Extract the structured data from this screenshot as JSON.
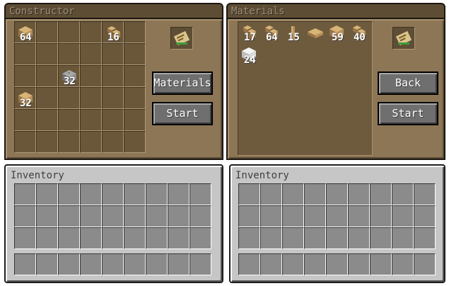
{
  "constructor": {
    "title": "Constructor",
    "materials_button": "Materials",
    "start_button": "Start",
    "items": [
      {
        "type": "wood-plank",
        "count": "64"
      },
      {
        "type": "wood-stairs",
        "count": "16"
      },
      {
        "type": "cobblestone",
        "count": "32"
      },
      {
        "type": "wood-plank",
        "count": "32"
      }
    ]
  },
  "materials": {
    "title": "Materials",
    "back_button": "Back",
    "start_button": "Start",
    "items": [
      {
        "type": "wood-stairs",
        "count": "17"
      },
      {
        "type": "wood-stairs",
        "count": "64"
      },
      {
        "type": "fence-post",
        "count": "15"
      },
      {
        "type": "wood-slab",
        "count": ""
      },
      {
        "type": "wood-plank",
        "count": "59"
      },
      {
        "type": "wood-stairs",
        "count": "40"
      },
      {
        "type": "wool-block",
        "count": "24"
      }
    ]
  },
  "inventory_left": {
    "title": "Inventory"
  },
  "inventory_right": {
    "title": "Inventory"
  },
  "colors": {
    "wood": "#c59a5c",
    "stone": "#8f8f8f",
    "wool": "#e6e6e6",
    "button": "#6f6f6f"
  }
}
